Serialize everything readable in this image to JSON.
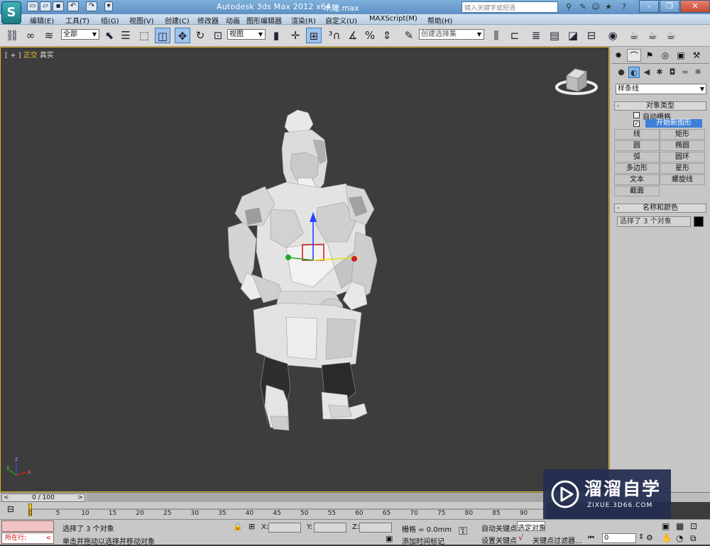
{
  "app": {
    "title": "Autodesk 3ds Max  2012 x64",
    "file_name": "木雕.max",
    "search_placeholder": "键入关键字或短语"
  },
  "menu": [
    "编辑(E)",
    "工具(T)",
    "组(G)",
    "视图(V)",
    "创建(C)",
    "修改器",
    "动画",
    "图形编辑器",
    "渲染(R)",
    "自定义(U)",
    "MAXScript(M)",
    "帮助(H)"
  ],
  "toolbar": {
    "selection_filter": "全部",
    "ref_coord": "视图",
    "named_selection": "创建选择集"
  },
  "viewport": {
    "label_prefix": "[ + ]",
    "view_name": "正交",
    "shading": "真实",
    "axis_x": "x",
    "axis_y": "y",
    "axis_z": "z"
  },
  "command_panel": {
    "category": "样条线",
    "object_type_title": "对象类型",
    "auto_grid": "自动栅格",
    "start_new_shape": "开始新图形",
    "buttons": [
      "线",
      "矩形",
      "圆",
      "椭圆",
      "弧",
      "圆环",
      "多边形",
      "星形",
      "文本",
      "螺旋线",
      "截面"
    ],
    "name_color_title": "名称和颜色",
    "name_field": "选择了 3 个对象",
    "color_swatch": "#000000"
  },
  "timeline": {
    "frame_display": "0 / 100",
    "ticks": [
      "0",
      "5",
      "10",
      "15",
      "20",
      "25",
      "30",
      "35",
      "40",
      "45",
      "50",
      "55",
      "60",
      "65",
      "70",
      "75",
      "80",
      "85",
      "90"
    ]
  },
  "status": {
    "script_prompt": "所在行:",
    "selection_info": "选择了 3 个对象",
    "hint": "单击并拖动以选择并移动对象",
    "x_label": "X:",
    "y_label": "Y:",
    "z_label": "Z:",
    "grid": "栅格 = 0.0mm",
    "add_time_tag": "添加时间标记",
    "auto_key": "自动关键点",
    "selected_dd": "选定对象",
    "set_key": "设置关键点",
    "key_filters": "关键点过滤器...",
    "frame_value": "0"
  },
  "watermark": {
    "brand": "溜溜自学",
    "url": "ZIXUE.3D66.COM"
  },
  "colors": {
    "viewport_bg": "#3d3d3d",
    "active_border": "#e4b31d",
    "highlight": "#3f7fd8"
  }
}
